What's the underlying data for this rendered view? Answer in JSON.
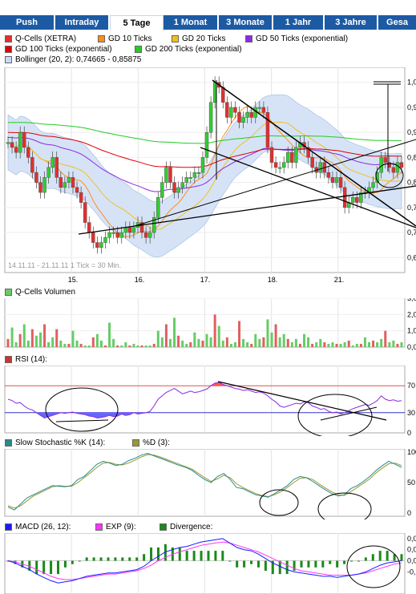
{
  "tabs": [
    "Push",
    "Intraday",
    "5 Tage",
    "1 Monat",
    "3 Monate",
    "1 Jahr",
    "3 Jahre",
    "Gesa"
  ],
  "active_tab": "5 Tage",
  "price_legend": [
    {
      "label": "Q-Cells (XETRA)",
      "color": "#e03030"
    },
    {
      "label": "GD 10 Ticks",
      "color": "#ff8c1a"
    },
    {
      "label": "GD 20 Ticks",
      "color": "#f0c020"
    },
    {
      "label": "GD 50 Ticks (exponential)",
      "color": "#8a2be2"
    },
    {
      "label": "GD 100 Ticks (exponential)",
      "color": "#e00000"
    },
    {
      "label": "GD 200 Ticks (exponential)",
      "color": "#22cc22"
    },
    {
      "label": "Bollinger (20, 2): 0,74665 - 0,85875",
      "color": "#c9daf8"
    }
  ],
  "period_note": "14.11.11 - 21.11.11   1 Tick = 30 Min.",
  "volume_legend": {
    "label": "Q-Cells Volumen",
    "color": "#66cc66"
  },
  "rsi_legend": {
    "label": "RSI (14):",
    "color": "#cc3333"
  },
  "stoch_legend": [
    {
      "label": "Slow Stochastic %K (14):",
      "color": "#2a8a8a"
    },
    {
      "label": "%D (3):",
      "color": "#999933"
    }
  ],
  "macd_legend": [
    {
      "label": "MACD (26, 12):",
      "color": "#1a1aff"
    },
    {
      "label": "EXP (9):",
      "color": "#ff33ff"
    },
    {
      "label": "Divergence:",
      "color": "#1a8a1a"
    }
  ],
  "chart_data": [
    {
      "type": "candlestick",
      "title": "Q-Cells (XETRA)",
      "x_ticks": [
        "15.",
        "16.",
        "17.",
        "18.",
        "21."
      ],
      "y_ticks": [
        "1,0",
        "0,9",
        "0,9",
        "0,8",
        "0,8",
        "0,7",
        "0,7",
        "0,6"
      ],
      "ylim": [
        0.62,
        1.03
      ],
      "grid": true,
      "close": [
        0.88,
        0.87,
        0.86,
        0.9,
        0.87,
        0.85,
        0.82,
        0.8,
        0.78,
        0.81,
        0.83,
        0.85,
        0.81,
        0.79,
        0.8,
        0.81,
        0.79,
        0.78,
        0.76,
        0.72,
        0.7,
        0.68,
        0.67,
        0.68,
        0.69,
        0.7,
        0.7,
        0.69,
        0.7,
        0.71,
        0.7,
        0.71,
        0.72,
        0.7,
        0.69,
        0.7,
        0.73,
        0.77,
        0.8,
        0.83,
        0.8,
        0.78,
        0.79,
        0.8,
        0.81,
        0.81,
        0.82,
        0.82,
        0.85,
        0.9,
        0.96,
        1.0,
        0.99,
        0.96,
        0.93,
        0.95,
        0.94,
        0.92,
        0.93,
        0.94,
        0.93,
        0.95,
        0.95,
        0.94,
        0.87,
        0.84,
        0.83,
        0.83,
        0.84,
        0.86,
        0.84,
        0.87,
        0.88,
        0.87,
        0.85,
        0.83,
        0.82,
        0.84,
        0.82,
        0.81,
        0.8,
        0.81,
        0.79,
        0.75,
        0.76,
        0.77,
        0.76,
        0.78,
        0.78,
        0.79,
        0.8,
        0.82,
        0.85,
        0.84,
        0.83,
        0.82,
        0.84,
        0.83
      ]
    },
    {
      "type": "bar",
      "title": "Q-Cells Volumen",
      "y_ticks": [
        "3,0",
        "2,0",
        "1,0",
        "0,0"
      ],
      "ylim": [
        0,
        3
      ],
      "values": [
        0.5,
        1.2,
        0.3,
        0.8,
        1.4,
        0.4,
        1.1,
        0.7,
        0.9,
        1.4,
        0.3,
        0.6,
        1.1,
        0.4,
        0.2,
        0.2,
        1.0,
        0.4,
        0.2,
        0.1,
        0.1,
        0.6,
        0.8,
        0.4,
        0.1,
        1.5,
        0.5,
        0.1,
        0.1,
        0.3,
        0.1,
        0.2,
        0.1,
        0.1,
        0.1,
        0.1,
        0.2,
        1.0,
        0.6,
        1.4,
        0.5,
        1.8,
        0.7,
        0.4,
        0.2,
        0.3,
        0.9,
        0.5,
        0.4,
        0.8,
        0.6,
        2.0,
        1.3,
        0.4,
        0.6,
        0.2,
        0.3,
        1.6,
        0.5,
        0.3,
        0.2,
        0.8,
        0.5,
        0.6,
        1.7,
        0.9,
        1.4,
        0.6,
        0.8,
        0.5,
        0.3,
        0.5,
        0.2,
        0.8,
        0.6,
        0.2,
        0.3,
        0.5,
        0.3,
        0.2,
        0.3,
        0.2,
        0.2,
        0.3,
        0.4,
        0.1,
        0.2,
        0.2,
        0.6,
        0.3,
        0.4,
        0.3,
        0.5,
        1.0,
        0.3,
        0.4,
        0.2,
        0.3
      ]
    },
    {
      "type": "line",
      "title": "RSI (14):",
      "y_ticks": [
        "70",
        "30",
        "0"
      ],
      "ylim": [
        0,
        100
      ],
      "overbought": 70,
      "oversold": 30,
      "values": [
        50,
        48,
        44,
        45,
        40,
        36,
        34,
        30,
        26,
        22,
        24,
        26,
        28,
        30,
        29,
        30,
        31,
        29,
        28,
        27,
        25,
        24,
        22,
        23,
        24,
        26,
        24,
        25,
        28,
        26,
        27,
        30,
        28,
        29,
        30,
        32,
        40,
        50,
        55,
        60,
        63,
        66,
        62,
        58,
        60,
        62,
        60,
        61,
        63,
        65,
        70,
        74,
        75,
        72,
        70,
        68,
        66,
        65,
        63,
        64,
        62,
        60,
        61,
        59,
        55,
        50,
        46,
        40,
        38,
        40,
        42,
        44,
        43,
        46,
        45,
        40,
        38,
        35,
        36,
        32,
        30,
        31,
        28,
        30,
        33,
        36,
        38,
        40,
        42,
        41,
        44,
        48,
        55,
        50,
        48,
        49,
        47,
        48
      ]
    },
    {
      "type": "line",
      "title": "Slow Stochastic %K (14):",
      "y_ticks": [
        "100",
        "50",
        "0"
      ],
      "ylim": [
        0,
        100
      ],
      "series": [
        {
          "name": "Slow Stochastic %K (14):",
          "values": [
            10,
            5,
            15,
            25,
            30,
            35,
            40,
            45,
            44,
            43,
            45,
            55,
            60,
            70,
            80,
            85,
            82,
            78,
            80,
            86,
            90,
            95,
            98,
            94,
            90,
            86,
            82,
            78,
            75,
            70,
            62,
            55,
            50,
            60,
            65,
            55,
            42,
            40,
            35,
            30,
            28,
            26,
            32,
            38,
            45,
            55,
            60,
            58,
            52,
            45,
            38,
            32,
            28,
            30,
            40,
            45,
            52,
            60,
            70,
            78,
            85,
            80,
            75
          ]
        },
        {
          "name": "%D (3):",
          "values": [
            12,
            8,
            12,
            20,
            28,
            33,
            38,
            43,
            45,
            44,
            44,
            50,
            58,
            66,
            75,
            82,
            83,
            80,
            79,
            82,
            87,
            92,
            96,
            95,
            92,
            88,
            84,
            80,
            76,
            72,
            65,
            58,
            52,
            56,
            62,
            58,
            48,
            42,
            37,
            32,
            29,
            27,
            30,
            35,
            42,
            50,
            57,
            58,
            55,
            48,
            41,
            35,
            30,
            29,
            35,
            42,
            49,
            56,
            66,
            74,
            81,
            82,
            78
          ]
        }
      ]
    },
    {
      "type": "line",
      "title": "MACD (26, 12):",
      "y_ticks": [
        "0,0",
        "0,0",
        "0,0",
        "-0,"
      ],
      "ylim": [
        -0.03,
        0.025
      ],
      "series": [
        {
          "name": "MACD (26, 12):",
          "values": [
            0.0,
            -0.002,
            -0.005,
            -0.008,
            -0.012,
            -0.015,
            -0.018,
            -0.02,
            -0.019,
            -0.018,
            -0.016,
            -0.014,
            -0.013,
            -0.012,
            -0.011,
            -0.011,
            -0.01,
            -0.009,
            -0.008,
            -0.005,
            0.0,
            0.004,
            0.008,
            0.01,
            0.012,
            0.013,
            0.015,
            0.017,
            0.018,
            0.019,
            0.02,
            0.016,
            0.012,
            0.01,
            0.009,
            0.006,
            0.002,
            -0.002,
            -0.005,
            -0.008,
            -0.01,
            -0.011,
            -0.012,
            -0.013,
            -0.014,
            -0.014,
            -0.015,
            -0.014,
            -0.013,
            -0.012,
            -0.01,
            -0.007,
            -0.004,
            -0.002,
            -0.001,
            0.0
          ]
        },
        {
          "name": "EXP (9):",
          "values": [
            0.0,
            -0.001,
            -0.003,
            -0.005,
            -0.008,
            -0.011,
            -0.014,
            -0.016,
            -0.017,
            -0.017,
            -0.016,
            -0.015,
            -0.014,
            -0.013,
            -0.012,
            -0.012,
            -0.011,
            -0.01,
            -0.009,
            -0.007,
            -0.004,
            0.0,
            0.003,
            0.006,
            0.008,
            0.01,
            0.012,
            0.014,
            0.015,
            0.016,
            0.017,
            0.016,
            0.014,
            0.012,
            0.01,
            0.008,
            0.005,
            0.002,
            -0.001,
            -0.004,
            -0.007,
            -0.009,
            -0.01,
            -0.011,
            -0.012,
            -0.013,
            -0.013,
            -0.013,
            -0.013,
            -0.012,
            -0.011,
            -0.009,
            -0.007,
            -0.005,
            -0.003,
            -0.002
          ]
        }
      ]
    }
  ]
}
